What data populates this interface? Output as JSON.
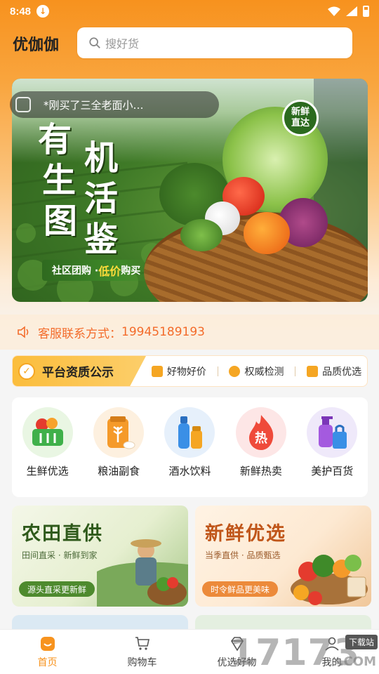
{
  "status": {
    "time": "8:48"
  },
  "header": {
    "brand": "优伽伽",
    "search_placeholder": "搜好货"
  },
  "banner": {
    "notice": "*刚买了三全老面小…",
    "title_col1": [
      "有",
      "生",
      "图"
    ],
    "title_col2": [
      "机",
      "活",
      "鉴"
    ],
    "badge_line1": "新鲜",
    "badge_line2": "直达",
    "slogan_a": "社区团购 · ",
    "slogan_b": "低价",
    "slogan_c": "购买"
  },
  "service": {
    "label": "客服联系方式：",
    "phone": "19945189193"
  },
  "quality": {
    "title": "平台资质公示",
    "items": [
      "好物好价",
      "权威检测",
      "品质优选"
    ]
  },
  "categories": [
    {
      "label": "生鲜优选",
      "icon": "basket-icon"
    },
    {
      "label": "粮油副食",
      "icon": "grain-bag-icon"
    },
    {
      "label": "酒水饮料",
      "icon": "bottles-icon"
    },
    {
      "label": "新鲜热卖",
      "icon": "hot-flame-icon",
      "badge": "热"
    },
    {
      "label": "美护百货",
      "icon": "cosmetics-icon"
    }
  ],
  "promos": [
    {
      "title": "农田直供",
      "sub": "田间直采 · 新鲜到家",
      "pill": "源头直采更新鲜"
    },
    {
      "title": "新鲜优选",
      "sub": "当季直供 · 品质甄选",
      "pill": "时令鲜品更美味"
    }
  ],
  "tabs": [
    {
      "label": "首页",
      "icon": "home-icon",
      "active": true
    },
    {
      "label": "购物车",
      "icon": "cart-icon",
      "active": false
    },
    {
      "label": "优选好物",
      "icon": "diamond-icon",
      "active": false
    },
    {
      "label": "我的",
      "icon": "person-icon",
      "active": false
    }
  ],
  "watermark": {
    "number": "17173",
    "download": "下载站",
    "com": ".COM"
  },
  "colors": {
    "accent": "#f7921e",
    "service_text": "#f36b2a",
    "banner_green": "#3f7a27"
  }
}
